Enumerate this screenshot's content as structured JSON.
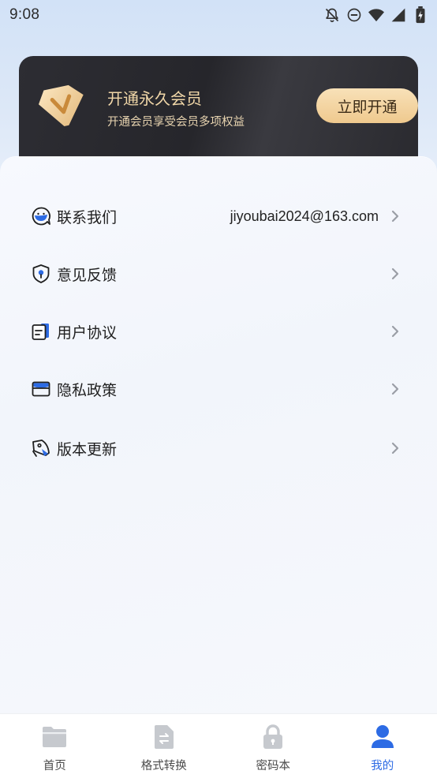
{
  "status_bar": {
    "time": "9:08",
    "icons": [
      "bell-off-icon",
      "dnd-icon",
      "wifi-icon",
      "signal-icon",
      "battery-icon"
    ]
  },
  "vip": {
    "title": "开通永久会员",
    "subtitle": "开通会员享受会员多项权益",
    "button_label": "立即开通",
    "badge_icon": "vip-badge-icon"
  },
  "menu": {
    "items": [
      {
        "label": "联系我们",
        "value": "jiyoubai2024@163.com",
        "icon": "chat-smile-icon"
      },
      {
        "label": "意见反馈",
        "value": "",
        "icon": "shield-icon"
      },
      {
        "label": "用户协议",
        "value": "",
        "icon": "document-icon"
      },
      {
        "label": "隐私政策",
        "value": "",
        "icon": "envelope-icon"
      },
      {
        "label": "版本更新",
        "value": "",
        "icon": "rocket-icon"
      }
    ]
  },
  "tabs": [
    {
      "label": "首页",
      "icon": "folder-icon",
      "active": false
    },
    {
      "label": "格式转换",
      "icon": "file-convert-icon",
      "active": false
    },
    {
      "label": "密码本",
      "icon": "lock-icon",
      "active": false
    },
    {
      "label": "我的",
      "icon": "user-icon",
      "active": true
    }
  ],
  "colors": {
    "accent": "#2d6be4",
    "vip_gold": "#f1d7a8",
    "vip_card": "#2a2a2f",
    "tab_inactive_icon": "#c9ccd1"
  }
}
